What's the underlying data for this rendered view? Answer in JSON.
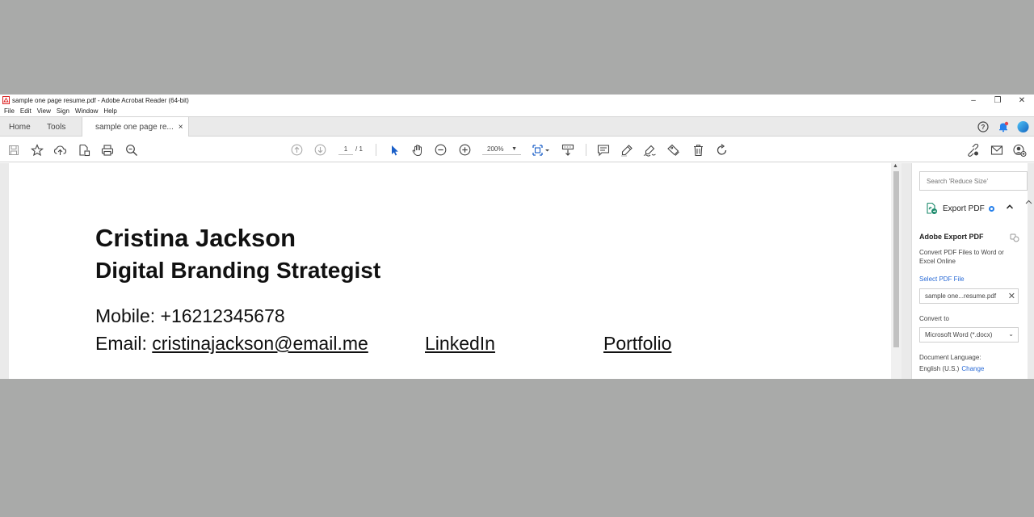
{
  "window": {
    "title": "sample one page resume.pdf - Adobe Acrobat Reader (64-bit)",
    "controls": {
      "minimize": "–",
      "restore": "❐",
      "close": "✕"
    }
  },
  "menu": [
    "File",
    "Edit",
    "View",
    "Sign",
    "Window",
    "Help"
  ],
  "tabs": {
    "home": "Home",
    "tools": "Tools",
    "document": "sample one page re...",
    "close": "×"
  },
  "toolbar": {
    "page_current": "1",
    "page_total": "/ 1",
    "zoom": "200%",
    "icons": [
      "save-icon",
      "star-icon",
      "upload-icon",
      "export-icon",
      "print-icon",
      "find-icon",
      "prev-page-icon",
      "next-page-icon",
      "select-cursor-icon",
      "hand-icon",
      "zoom-out-icon",
      "zoom-in-icon",
      "fit-page-icon",
      "scroll-mode-icon",
      "comment-icon",
      "highlight-icon",
      "sign-icon",
      "stamp-icon",
      "delete-icon",
      "rotate-icon",
      "share-link-icon",
      "email-icon",
      "account-icon"
    ]
  },
  "document": {
    "name": "Cristina Jackson",
    "title": "Digital Branding Strategist",
    "mobile": "Mobile: +16212345678",
    "email_label": "Email: ",
    "email": "cristinajackson@email.me",
    "linkedin": "LinkedIn",
    "portfolio": "Portfolio"
  },
  "right_pane": {
    "search_placeholder": "Search 'Reduce Size'",
    "export_label": "Export PDF",
    "heading": "Adobe Export PDF",
    "description": "Convert PDF Files to Word or Excel Online",
    "select_file": "Select PDF File",
    "file_name": "sample one...resume.pdf",
    "convert_to": "Convert to",
    "format": "Microsoft Word (*.docx)",
    "doc_language_label": "Document Language:",
    "doc_language": "English (U.S.)",
    "change": "Change"
  },
  "colors": {
    "accent_blue": "#2680eb",
    "link_blue": "#2a6bd6",
    "notification_red": "#e34850"
  }
}
